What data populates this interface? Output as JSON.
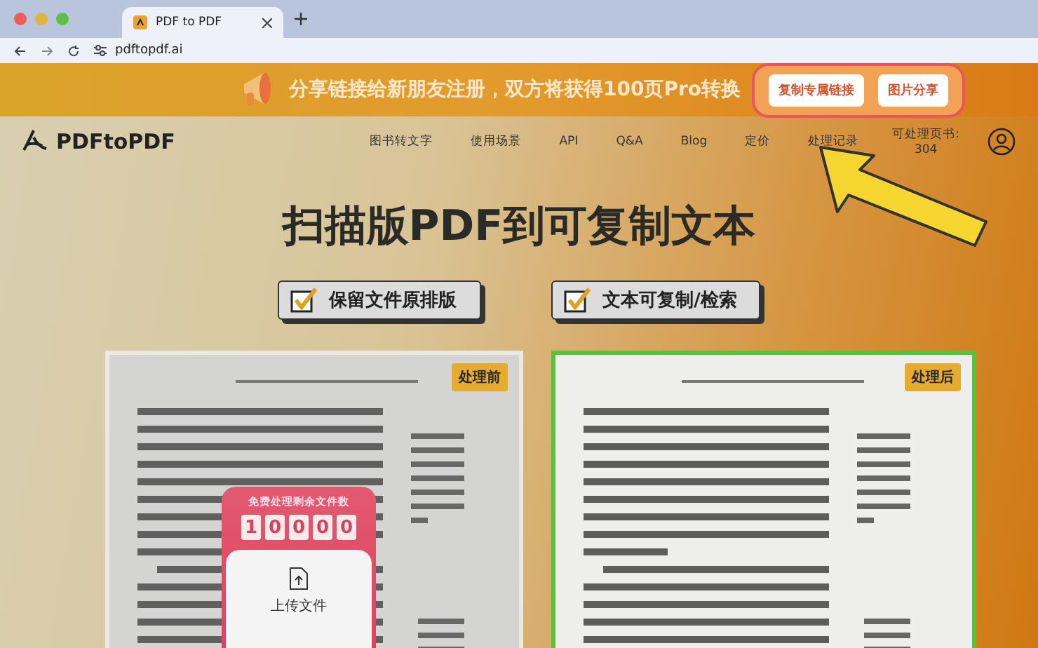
{
  "browser": {
    "tab_title": "PDF to PDF",
    "url": "pdftopdf.ai"
  },
  "banner": {
    "text": "分享链接给新朋友注册，双方将获得100页Pro转换",
    "buttons": [
      "复制专属链接",
      "图片分享"
    ]
  },
  "nav": {
    "logo": "PDFtoPDF",
    "items": [
      "图书转文字",
      "使用场景",
      "API",
      "Q&A",
      "Blog",
      "定价",
      "处理记录"
    ],
    "pages_label": "可处理页书:",
    "pages_count": "304"
  },
  "hero": {
    "title": "扫描版PDF到可复制文本",
    "features": [
      {
        "label": "保留文件原排版",
        "checked": true
      },
      {
        "label": "文本可复制/检索",
        "checked": true
      }
    ]
  },
  "samples": [
    {
      "badge": "处理前",
      "kind": "scan"
    },
    {
      "badge": "处理后",
      "kind": "clean"
    }
  ],
  "upload": {
    "caption": "免费处理剩余文件数",
    "digits": [
      "1",
      "0",
      "0",
      "0",
      "0"
    ],
    "label": "上传文件"
  }
}
